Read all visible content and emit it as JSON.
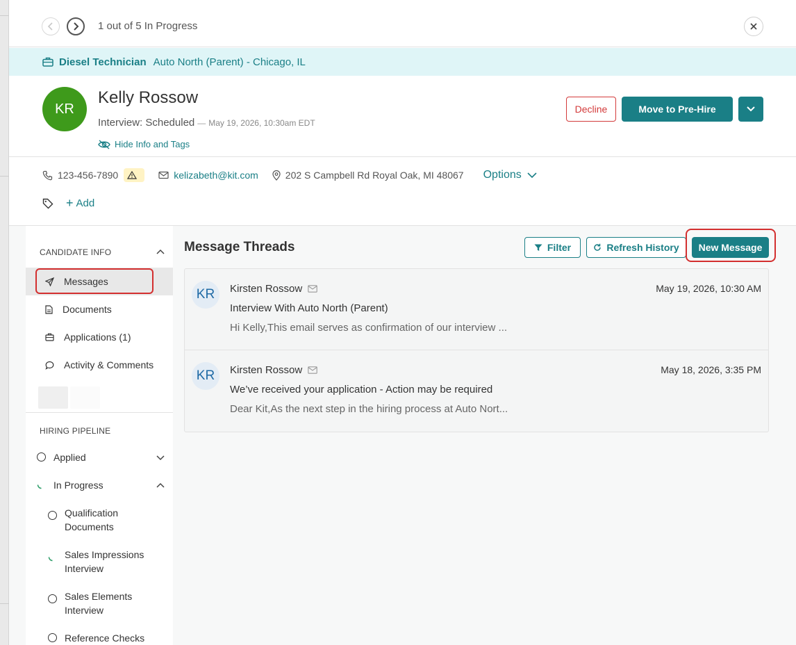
{
  "nav": {
    "counter": "1 out of 5 In Progress"
  },
  "job": {
    "title": "Diesel Technician",
    "location": "Auto North (Parent) - Chicago, IL"
  },
  "candidate": {
    "initials": "KR",
    "name": "Kelly Rossow",
    "status": "Interview: Scheduled",
    "dash": "—",
    "status_date": "May 19, 2026, 10:30am EDT",
    "hide_info_label": "Hide Info and Tags",
    "phone": "123-456-7890",
    "email": "kelizabeth@kit.com",
    "address": "202 S Campbell Rd Royal Oak, MI 48067",
    "options_label": "Options",
    "add_tag_label": "Add"
  },
  "actions": {
    "decline_label": "Decline",
    "move_label": "Move to Pre-Hire"
  },
  "sidebar": {
    "candidate_info_heading": "CANDIDATE INFO",
    "items": [
      {
        "label": "Messages",
        "icon": "send-icon",
        "active": true
      },
      {
        "label": "Documents",
        "icon": "document-icon"
      },
      {
        "label": "Applications (1)",
        "icon": "briefcase-icon"
      },
      {
        "label": "Activity & Comments",
        "icon": "comment-icon"
      }
    ],
    "pipeline_heading": "HIRING PIPELINE",
    "pipeline": [
      {
        "label": "Applied",
        "state": "not-started"
      },
      {
        "label": "In Progress",
        "state": "in-progress"
      },
      {
        "label": "Qualification Documents",
        "state": "not-started"
      },
      {
        "label": "Sales Impressions Interview",
        "state": "in-progress"
      },
      {
        "label": "Sales Elements Interview",
        "state": "not-started"
      },
      {
        "label": "Reference Checks",
        "state": "not-started"
      }
    ]
  },
  "main": {
    "title": "Message Threads",
    "filter_label": "Filter",
    "refresh_label": "Refresh History",
    "new_message_label": "New Message",
    "threads": [
      {
        "initials": "KR",
        "sender": "Kirsten Rossow",
        "date": "May 19, 2026, 10:30 AM",
        "subject": "Interview With Auto North (Parent)",
        "preview": "Hi Kelly,This email serves as confirmation of our interview ..."
      },
      {
        "initials": "KR",
        "sender": "Kirsten Rossow",
        "date": "May 18, 2026, 3:35 PM",
        "subject": "We’ve received your application - Action may be required",
        "preview": "Dear Kit,As the next step in the hiring process at Auto Nort..."
      }
    ]
  },
  "colors": {
    "accent": "#1a7f86",
    "danger": "#d33a3a",
    "avatar_green": "#3e9a1b",
    "banner_bg": "#dff5f7",
    "highlight_red": "#d32f2f"
  }
}
